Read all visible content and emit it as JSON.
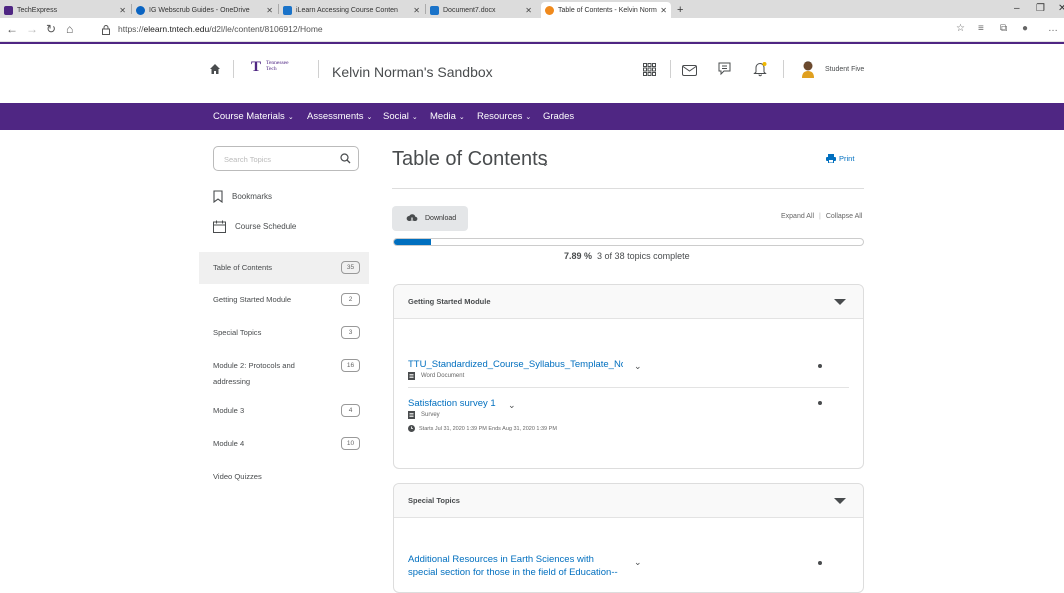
{
  "browser": {
    "tabs": [
      {
        "title": "TechExpress"
      },
      {
        "title": "IG Webscrub Guides - OneDrive"
      },
      {
        "title": "iLearn Accessing Course Conten"
      },
      {
        "title": "Document7.docx"
      },
      {
        "title": "Table of Contents - Kelvin Norm"
      }
    ],
    "new_tab": "+",
    "url_prefix": "https://",
    "url_host": "elearn.tntech.edu",
    "url_path": "/d2l/le/content/8106912/Home"
  },
  "header": {
    "logo_line1": "Tennessee",
    "logo_line2": "Tech",
    "org_title": "Kelvin Norman's Sandbox",
    "user_name": "Student Five"
  },
  "navbar": {
    "items": [
      {
        "label": "Course Materials"
      },
      {
        "label": "Assessments"
      },
      {
        "label": "Social"
      },
      {
        "label": "Media"
      },
      {
        "label": "Resources"
      },
      {
        "label": "Grades"
      }
    ]
  },
  "sidebar": {
    "search_placeholder": "Search Topics",
    "bookmarks": "Bookmarks",
    "course_schedule": "Course Schedule",
    "items": [
      {
        "label": "Table of Contents",
        "count": "35"
      },
      {
        "label": "Getting Started Module",
        "count": "2"
      },
      {
        "label": "Special Topics",
        "count": "3"
      },
      {
        "label": "Module 2: Protocols and addressing",
        "count": "16"
      },
      {
        "label": "Module 3",
        "count": "4"
      },
      {
        "label": "Module 4",
        "count": "10"
      },
      {
        "label": "Video Quizzes",
        "count": ""
      }
    ]
  },
  "main": {
    "title": "Table of Contents",
    "print": "Print",
    "download": "Download",
    "expand_all": "Expand All",
    "collapse_all": "Collapse All",
    "progress_percent_text": "7.89 %",
    "progress_fraction": 0.0789,
    "progress_text": "3 of 38 topics complete",
    "modules": [
      {
        "title": "Getting Started Module",
        "topics": [
          {
            "title": "TTU_Standardized_Course_Syllabus_Template_Nov",
            "type": "Word Document"
          },
          {
            "title": "Satisfaction survey 1",
            "type": "Survey",
            "dates": "Starts Jul 31, 2020 1:39 PM  Ends Aug 31, 2020 1:39 PM"
          }
        ]
      },
      {
        "title": "Special Topics",
        "topics": [
          {
            "title_line1": "Additional Resources in Earth Sciences with",
            "title_line2": "special section for those in the field of Education--"
          }
        ]
      }
    ]
  },
  "colors": {
    "brand_purple": "#4f2683",
    "link_blue": "#006fbf"
  }
}
